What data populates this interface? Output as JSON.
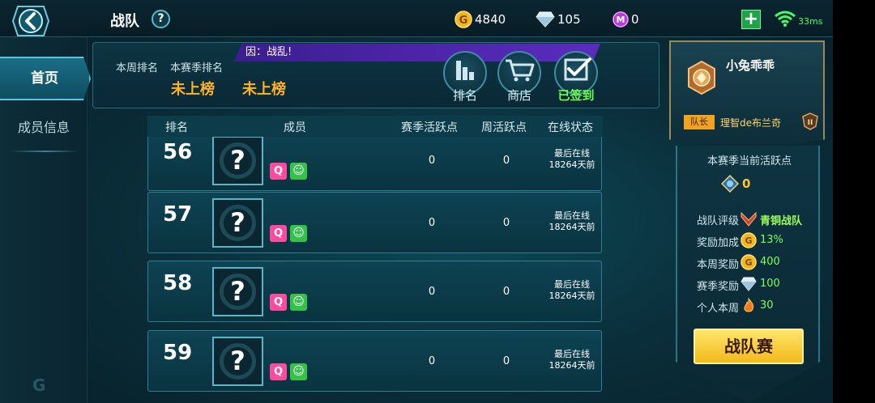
{
  "header": {
    "title": "战队",
    "help_label": "?",
    "gold": "4840",
    "diamond": "105",
    "gem": "0",
    "plus_label": "+",
    "ping": "33ms"
  },
  "sidebar": {
    "items": [
      {
        "label": "首页",
        "active": true
      },
      {
        "label": "成员信息",
        "active": false
      }
    ]
  },
  "rank_panel": {
    "week_rank_label": "本周排名",
    "season_rank_label": "本赛季排名",
    "week_rank_value": "未上榜",
    "season_rank_value": "未上榜",
    "announcement": "因：战乱!",
    "buttons": [
      {
        "label": "排名",
        "icon": "bar-chart-icon"
      },
      {
        "label": "商店",
        "icon": "shopping-cart-icon"
      },
      {
        "label": "已签到",
        "icon": "checkbox-checked-icon"
      }
    ]
  },
  "table": {
    "headers": {
      "rank": "排名",
      "member": "成员",
      "season_activity": "赛季活跃点",
      "week_activity": "周活跃点",
      "status": "在线状态"
    },
    "rows": [
      {
        "rank": "56",
        "avatar": "?",
        "tag_f": "Q",
        "tag_s": "☺",
        "season": "0",
        "week": "0",
        "status_line1": "最后在线",
        "status_line2": "18264天前"
      },
      {
        "rank": "57",
        "avatar": "?",
        "tag_f": "Q",
        "tag_s": "☺",
        "season": "0",
        "week": "0",
        "status_line1": "最后在线",
        "status_line2": "18264天前"
      },
      {
        "rank": "58",
        "avatar": "?",
        "tag_f": "Q",
        "tag_s": "☺",
        "season": "0",
        "week": "0",
        "status_line1": "最后在线",
        "status_line2": "18264天前"
      },
      {
        "rank": "59",
        "avatar": "?",
        "tag_f": "Q",
        "tag_s": "☺",
        "season": "0",
        "week": "0",
        "status_line1": "最后在线",
        "status_line2": "18264天前"
      }
    ]
  },
  "profile": {
    "name": "小兔乖乖",
    "role": "队长",
    "team": "理智de布兰奇",
    "current_activity_label": "本赛季当前活跃点",
    "current_activity_value": "0",
    "grade_label": "战队评级",
    "grade_value": "青铜战队",
    "bonus_label": "奖励加成",
    "bonus_value": "13%",
    "week_reward_label": "本周奖励",
    "week_reward_value": "400",
    "season_reward_label": "赛季奖励",
    "season_reward_value": "100",
    "personal_week_label": "个人本周",
    "personal_week_value": "30",
    "battle_button": "战队赛"
  },
  "colors": {
    "accent_gold": "#ffb21e",
    "accent_green": "#7dff5a",
    "panel_border": "#2e7d90"
  }
}
